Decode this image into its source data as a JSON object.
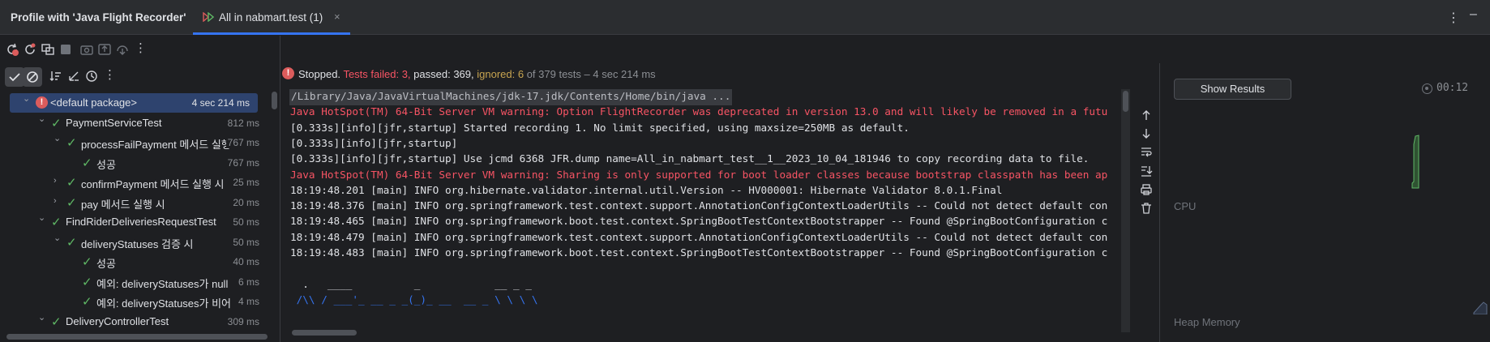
{
  "header": {
    "title": "Profile with 'Java Flight Recorder'",
    "tab_label": "All in nabmart.test (1)",
    "tab_close": "×"
  },
  "status": {
    "stopped": "Stopped.",
    "failed": "Tests failed: 3,",
    "passed": "passed: 369,",
    "ignored": "ignored: 6",
    "total": "of 379 tests – 4 sec 214 ms"
  },
  "tree": {
    "rows": [
      {
        "name": "<default package>",
        "time": "4 sec 214 ms",
        "status": "error",
        "expanded": true,
        "depth": 0
      },
      {
        "name": "PaymentServiceTest",
        "time": "812 ms",
        "status": "pass",
        "expanded": true,
        "depth": 1
      },
      {
        "name": "processFailPayment 메서드 실행",
        "time": "767 ms",
        "status": "pass",
        "expanded": true,
        "depth": 2
      },
      {
        "name": "성공",
        "time": "767 ms",
        "status": "pass",
        "expanded": null,
        "depth": 3
      },
      {
        "name": "confirmPayment 메서드 실행 시",
        "time": "25 ms",
        "status": "pass",
        "expanded": false,
        "depth": 2
      },
      {
        "name": "pay 메서드 실행 시",
        "time": "20 ms",
        "status": "pass",
        "expanded": false,
        "depth": 2
      },
      {
        "name": "FindRiderDeliveriesRequestTest",
        "time": "50 ms",
        "status": "pass",
        "expanded": true,
        "depth": 1
      },
      {
        "name": "deliveryStatuses 검증 시",
        "time": "50 ms",
        "status": "pass",
        "expanded": true,
        "depth": 2
      },
      {
        "name": "성공",
        "time": "40 ms",
        "status": "pass",
        "expanded": null,
        "depth": 3
      },
      {
        "name": "예외: deliveryStatuses가 null",
        "time": "6 ms",
        "status": "pass",
        "expanded": null,
        "depth": 3
      },
      {
        "name": "예외: deliveryStatuses가 비어 있",
        "time": "4 ms",
        "status": "pass",
        "expanded": null,
        "depth": 3
      },
      {
        "name": "DeliveryControllerTest",
        "time": "309 ms",
        "status": "pass",
        "expanded": true,
        "depth": 1
      }
    ]
  },
  "console": {
    "lines": [
      {
        "text": "/Library/Java/JavaVirtualMachines/jdk-17.jdk/Contents/Home/bin/java ...",
        "kind": "cmd"
      },
      {
        "text": "Java HotSpot(TM) 64-Bit Server VM warning: Option FlightRecorder was deprecated in version 13.0 and will likely be removed in a futu",
        "kind": "warn"
      },
      {
        "text": "[0.333s][info][jfr,startup] Started recording 1. No limit specified, using maxsize=250MB as default.",
        "kind": "norm"
      },
      {
        "text": "[0.333s][info][jfr,startup]",
        "kind": "norm"
      },
      {
        "text": "[0.333s][info][jfr,startup] Use jcmd 6368 JFR.dump name=All_in_nabmart_test__1__2023_10_04_181946 to copy recording data to file.",
        "kind": "norm"
      },
      {
        "text": "Java HotSpot(TM) 64-Bit Server VM warning: Sharing is only supported for boot loader classes because bootstrap classpath has been ap",
        "kind": "warn"
      },
      {
        "text": "18:19:48.201 [main] INFO org.hibernate.validator.internal.util.Version -- HV000001: Hibernate Validator 8.0.1.Final",
        "kind": "norm"
      },
      {
        "text": "18:19:48.376 [main] INFO org.springframework.test.context.support.AnnotationConfigContextLoaderUtils -- Could not detect default con",
        "kind": "norm"
      },
      {
        "text": "18:19:48.465 [main] INFO org.springframework.boot.test.context.SpringBootTestContextBootstrapper -- Found @SpringBootConfiguration c",
        "kind": "norm"
      },
      {
        "text": "18:19:48.479 [main] INFO org.springframework.test.context.support.AnnotationConfigContextLoaderUtils -- Could not detect default con",
        "kind": "norm"
      },
      {
        "text": "18:19:48.483 [main] INFO org.springframework.boot.test.context.SpringBootTestContextBootstrapper -- Found @SpringBootConfiguration c",
        "kind": "norm"
      },
      {
        "text": "",
        "kind": "norm"
      },
      {
        "text": "  .   ____          _            __ _ _",
        "kind": "ascii"
      },
      {
        "text": " /\\\\ / ___'_ __ _ _(_)_ __  __ _ \\ \\ \\ \\",
        "kind": "ascii-blue"
      }
    ]
  },
  "profiler": {
    "show_results": "Show Results",
    "timer": "00:12",
    "cpu_label": "CPU",
    "heap_label": "Heap Memory"
  },
  "colors": {
    "accent": "#3574f0",
    "pass": "#5fb865",
    "fail": "#f75464",
    "ignored": "#c7a450",
    "background": "#1e1f22",
    "panel": "#2b2d30"
  },
  "icons": {
    "toolbar1": [
      "rerun-failed-icon",
      "rerun-icon",
      "rerun-automatically-icon",
      "stop-icon",
      "screenshot-icon",
      "export-icon",
      "import-icon",
      "more-icon"
    ],
    "toolbar2": [
      "show-passed-icon",
      "show-ignored-icon",
      "sort-alpha-icon",
      "sort-duration-icon",
      "history-icon",
      "more-icon"
    ],
    "side": [
      "scroll-up-icon",
      "scroll-down-icon",
      "soft-wrap-icon",
      "scroll-to-end-icon",
      "print-icon",
      "clear-icon"
    ]
  }
}
